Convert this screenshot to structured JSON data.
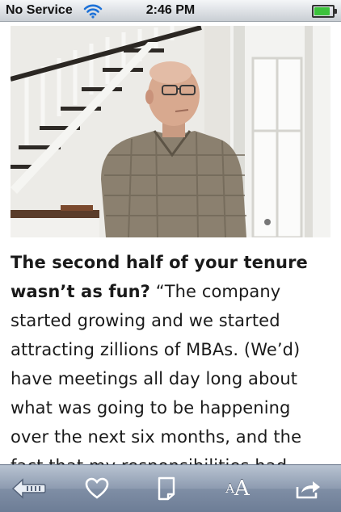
{
  "status_bar": {
    "carrier": "No Service",
    "time": "2:46 PM",
    "battery_level": 0.85,
    "battery_color": "#3cc23c"
  },
  "photo": {
    "icon": "portrait-photo"
  },
  "article": {
    "lead": "The second half of your tenure wasn’t as fun?",
    "body": " “The company started growing and we started attracting zillions of MBAs. (We’d) have meetings all day long about what was going to be happening over the next six months, and the fact that my responsibilities had"
  },
  "toolbar": {
    "back_icon": "back-arrow-icon",
    "favorite_icon": "heart-icon",
    "notes_icon": "page-icon",
    "font_small": "A",
    "font_large": "A",
    "share_icon": "share-arrow-icon"
  }
}
